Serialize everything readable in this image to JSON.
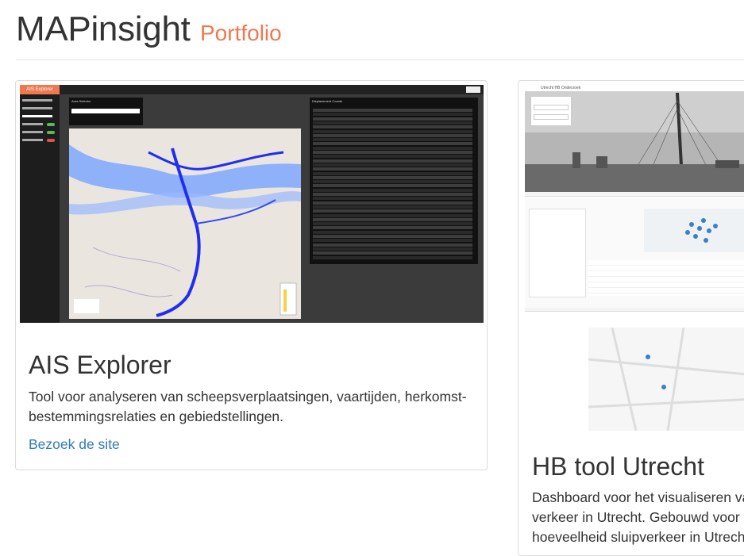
{
  "header": {
    "title": "MAPinsight",
    "subtitle": "Portfolio"
  },
  "colors": {
    "accent": "#f0784f",
    "link": "#337ab7",
    "text": "#333333",
    "border": "#dddddd"
  },
  "cards": [
    {
      "title": "AIS Explorer",
      "description": "Tool voor analyseren van scheepsverplaatsingen, vaartijden, herkomst-bestemmingsrelaties en gebiedstellingen.",
      "link_label": "Bezoek de site",
      "thumbnail": {
        "app_name": "AIS Explorer",
        "panel_title": "Area Selector",
        "list_title": "Displacement Counts"
      }
    },
    {
      "title": "HB tool Utrecht",
      "description_lines": [
        "Dashboard voor het visualiseren va",
        "verkeer in Utrecht. Gebouwd voor",
        "hoeveelheid sluipverkeer in Utrech"
      ],
      "thumbnail": {
        "app_name": "Utrecht HB Onderzoek"
      }
    }
  ]
}
